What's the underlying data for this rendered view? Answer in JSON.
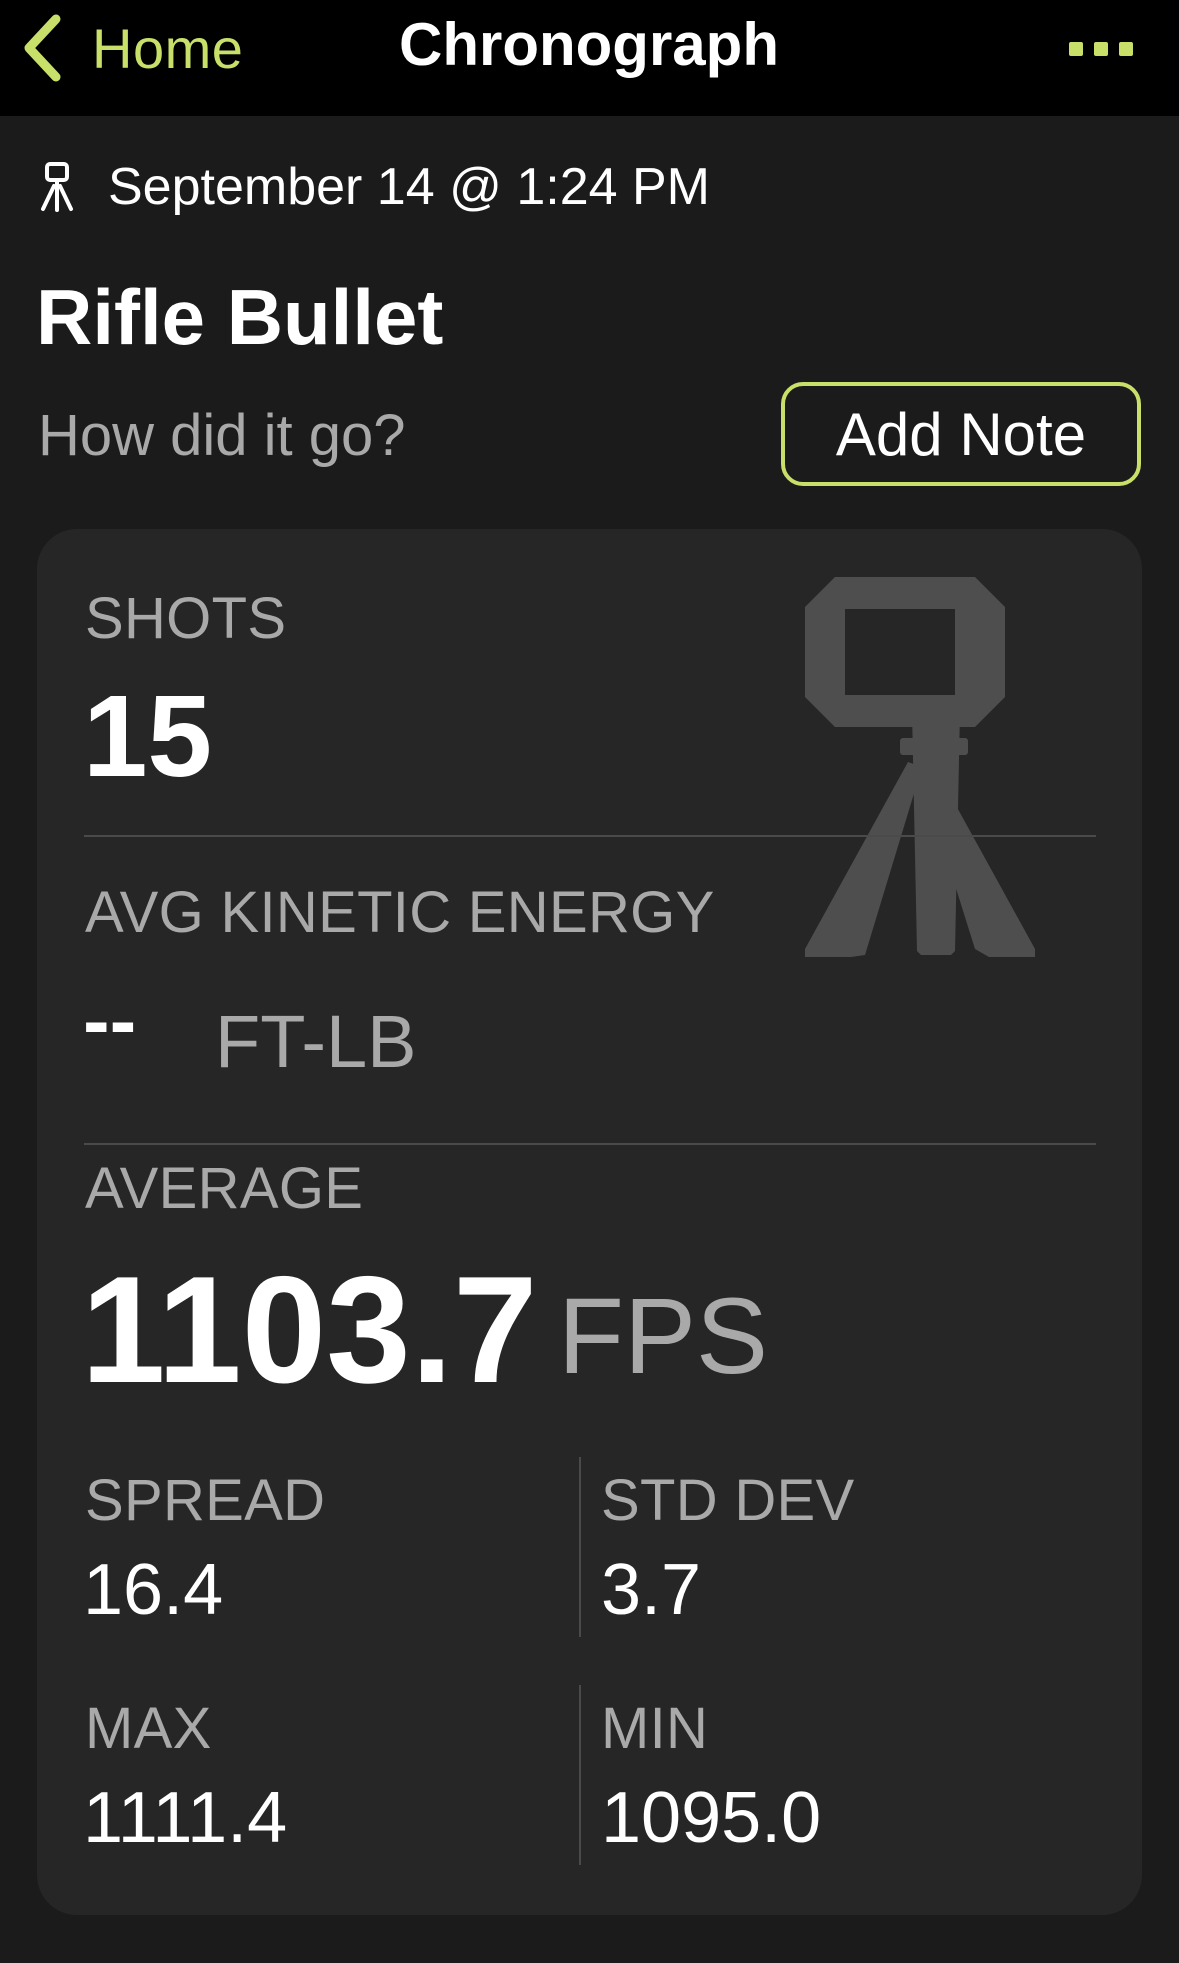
{
  "nav": {
    "back_label": "Home",
    "title": "Chronograph",
    "more_icon": "ellipsis-icon",
    "accent_color": "#c8e06a"
  },
  "session": {
    "date_icon": "chronograph-tripod-icon",
    "date": "September 14 @ 1:24 PM",
    "title": "Rifle Bullet",
    "note_prompt": "How did it go?",
    "add_note_label": "Add Note"
  },
  "stats": {
    "shots_label": "SHOTS",
    "shots_value": "15",
    "energy_label": "AVG KINETIC ENERGY",
    "energy_value": "--",
    "energy_unit": "FT-LB",
    "average_label": "AVERAGE",
    "average_value": "1103.7",
    "average_unit": "FPS",
    "spread_label": "SPREAD",
    "spread_value": "16.4",
    "stddev_label": "STD DEV",
    "stddev_value": "3.7",
    "max_label": "MAX",
    "max_value": "1111.4",
    "min_label": "MIN",
    "min_value": "1095.0",
    "decor_icon": "chronograph-tripod-icon"
  }
}
